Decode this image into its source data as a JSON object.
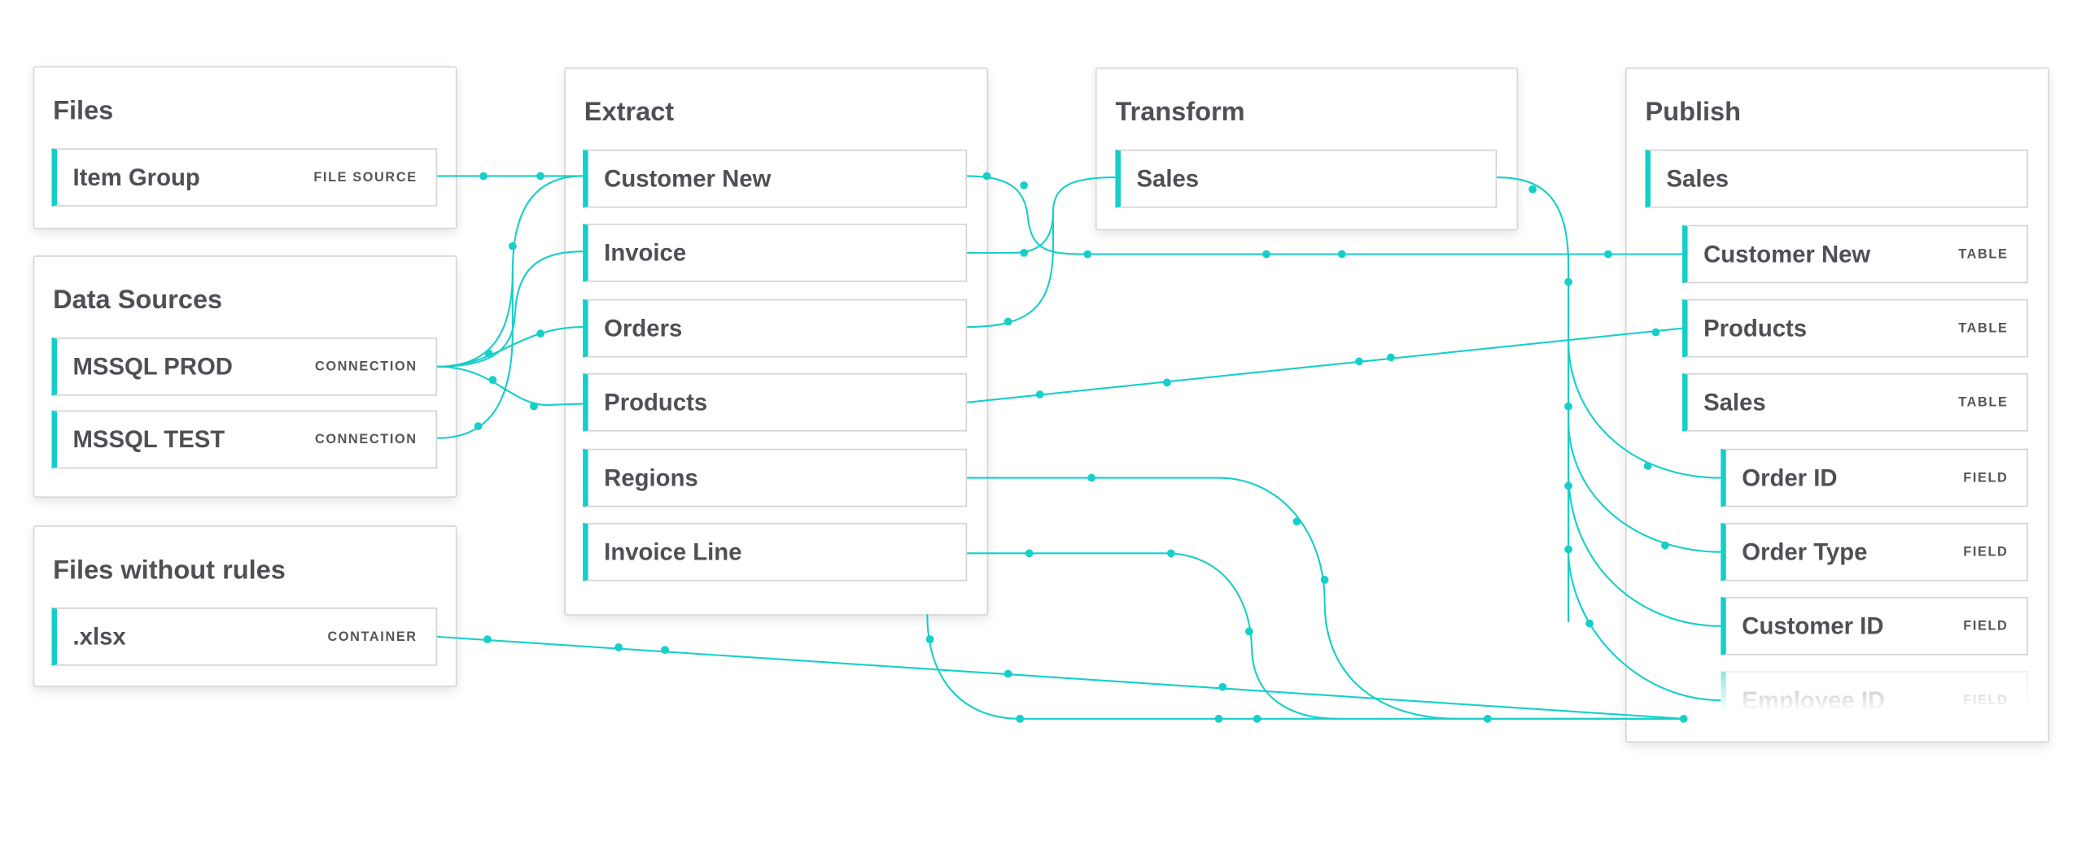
{
  "accent_color": "#14cec8",
  "line_color": "#17cfc9",
  "files": {
    "title": "Files",
    "rows": [
      {
        "label": "Item Group",
        "type": "FILE SOURCE"
      }
    ]
  },
  "data_sources": {
    "title": "Data Sources",
    "rows": [
      {
        "label": "MSSQL PROD",
        "type": "CONNECTION"
      },
      {
        "label": "MSSQL TEST",
        "type": "CONNECTION"
      }
    ]
  },
  "files_without_rules": {
    "title": "Files without rules",
    "rows": [
      {
        "label": ".xlsx",
        "type": "CONTAINER"
      }
    ]
  },
  "extract": {
    "title": "Extract",
    "rows": [
      {
        "label": "Customer New"
      },
      {
        "label": "Invoice"
      },
      {
        "label": "Orders"
      },
      {
        "label": "Products"
      },
      {
        "label": "Regions"
      },
      {
        "label": "Invoice Line"
      }
    ]
  },
  "transform": {
    "title": "Transform",
    "rows": [
      {
        "label": "Sales"
      }
    ]
  },
  "publish": {
    "title": "Publish",
    "rows": [
      {
        "label": "Sales"
      },
      {
        "label": "Customer New",
        "type": "TABLE"
      },
      {
        "label": "Products",
        "type": "TABLE"
      },
      {
        "label": "Sales",
        "type": "TABLE"
      },
      {
        "label": "Order ID",
        "type": "FIELD"
      },
      {
        "label": "Order Type",
        "type": "FIELD"
      },
      {
        "label": "Customer ID",
        "type": "FIELD"
      },
      {
        "label": "Employee ID",
        "type": "FIELD"
      }
    ]
  }
}
